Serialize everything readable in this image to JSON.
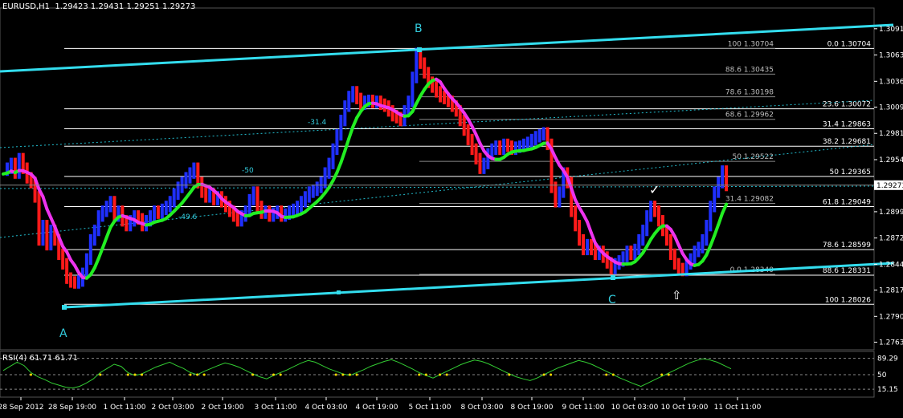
{
  "header": {
    "symbol": "EURUSD,H1",
    "ohlc": "1.29423 1.29431 1.29251 1.29273"
  },
  "rsi_header": {
    "label": "RSI(4) 61.71 61.71"
  },
  "colors": {
    "background": "#000000",
    "bull_bar": "#1f2fff",
    "bear_bar": "#ff1a1a",
    "ma_up": "#22ee22",
    "ma_down": "#ee33ee",
    "channel": "#33ddee",
    "fib_line": "#ffffff",
    "rsi_line": "#33cc33",
    "rsi_dot": "#ffdd00"
  },
  "chart_data": [
    {
      "type": "line",
      "description_source": "EURUSD H1 price panel",
      "y_axis_ticks": [
        "1.30910",
        "1.30635",
        "1.30360",
        "1.30090",
        "1.29815",
        "1.29540",
        "1.29273",
        "1.28995",
        "1.28720",
        "1.28445",
        "1.28175",
        "1.27900",
        "1.27630"
      ],
      "current_price": "1.29273",
      "x_axis_ticks": [
        "28 Sep 2012",
        "28 Sep 19:00",
        "1 Oct 11:00",
        "2 Oct 03:00",
        "2 Oct 19:00",
        "3 Oct 11:00",
        "4 Oct 03:00",
        "4 Oct 19:00",
        "5 Oct 11:00",
        "8 Oct 03:00",
        "8 Oct 19:00",
        "9 Oct 11:00",
        "10 Oct 03:00",
        "10 Oct 19:00",
        "11 Oct 11:00"
      ],
      "wave_labels": [
        "A",
        "B",
        "C"
      ],
      "fib_levels_right": [
        {
          "label": "0.0 1.30704",
          "price": 1.30704
        },
        {
          "label": "23.6 1.30072",
          "price": 1.30072
        },
        {
          "label": "31.4 1.29863",
          "price": 1.29863
        },
        {
          "label": "38.2 1.29681",
          "price": 1.29681
        },
        {
          "label": "50 1.29365",
          "price": 1.29365
        },
        {
          "label": "61.8 1.29049",
          "price": 1.29049
        },
        {
          "label": "78.6 1.28599",
          "price": 1.28599
        },
        {
          "label": "88.6 1.28331",
          "price": 1.28331
        },
        {
          "label": "100 1.28026",
          "price": 1.28026
        }
      ],
      "fib_levels_inner": [
        {
          "label": "100 1.30704",
          "price": 1.30704
        },
        {
          "label": "88.6 1.30435",
          "price": 1.30435
        },
        {
          "label": "78.6 1.30198",
          "price": 1.30198
        },
        {
          "label": "68.6 1.29962",
          "price": 1.29962
        },
        {
          "label": "50 1.29522",
          "price": 1.29522
        },
        {
          "label": "31.4 1.29082",
          "price": 1.29082
        },
        {
          "label": "0.0 1.28340",
          "price": 1.2834
        }
      ],
      "pct_labels": [
        "-31.4",
        "-50",
        "-49.6"
      ],
      "price_path": [
        [
          0,
          1.2943
        ],
        [
          5,
          1.2945
        ],
        [
          10,
          1.295
        ],
        [
          15,
          1.294
        ],
        [
          20,
          1.2955
        ],
        [
          25,
          1.2945
        ],
        [
          30,
          1.2935
        ],
        [
          35,
          1.293
        ],
        [
          40,
          1.2915
        ],
        [
          45,
          1.287
        ],
        [
          50,
          1.2885
        ],
        [
          55,
          1.2865
        ],
        [
          60,
          1.288
        ],
        [
          65,
          1.287
        ],
        [
          70,
          1.2855
        ],
        [
          75,
          1.2845
        ],
        [
          80,
          1.283
        ],
        [
          85,
          1.2826
        ],
        [
          90,
          1.2825
        ],
        [
          95,
          1.2827
        ],
        [
          100,
          1.2835
        ],
        [
          105,
          1.285
        ],
        [
          110,
          1.287
        ],
        [
          115,
          1.288
        ],
        [
          120,
          1.2895
        ],
        [
          125,
          1.29
        ],
        [
          130,
          1.2905
        ],
        [
          135,
          1.291
        ],
        [
          140,
          1.2895
        ],
        [
          145,
          1.29
        ],
        [
          150,
          1.289
        ],
        [
          155,
          1.2885
        ],
        [
          160,
          1.289
        ],
        [
          165,
          1.2895
        ],
        [
          170,
          1.2892
        ],
        [
          175,
          1.2885
        ],
        [
          180,
          1.289
        ],
        [
          185,
          1.2895
        ],
        [
          190,
          1.29
        ],
        [
          195,
          1.2898
        ],
        [
          200,
          1.2902
        ],
        [
          205,
          1.2905
        ],
        [
          210,
          1.291
        ],
        [
          215,
          1.2918
        ],
        [
          220,
          1.2925
        ],
        [
          225,
          1.293
        ],
        [
          230,
          1.2935
        ],
        [
          235,
          1.294
        ],
        [
          240,
          1.2945
        ],
        [
          245,
          1.293
        ],
        [
          250,
          1.292
        ],
        [
          255,
          1.2915
        ],
        [
          260,
          1.2918
        ],
        [
          265,
          1.2912
        ],
        [
          270,
          1.2915
        ],
        [
          275,
          1.291
        ],
        [
          280,
          1.2905
        ],
        [
          285,
          1.29
        ],
        [
          290,
          1.2895
        ],
        [
          295,
          1.289
        ],
        [
          300,
          1.2895
        ],
        [
          305,
          1.29
        ],
        [
          310,
          1.2912
        ],
        [
          315,
          1.292
        ],
        [
          320,
          1.2905
        ],
        [
          325,
          1.2898
        ],
        [
          330,
          1.29
        ],
        [
          335,
          1.2895
        ],
        [
          340,
          1.2898
        ],
        [
          345,
          1.29
        ],
        [
          350,
          1.2895
        ],
        [
          355,
          1.2897
        ],
        [
          360,
          1.29
        ],
        [
          365,
          1.2902
        ],
        [
          370,
          1.2905
        ],
        [
          375,
          1.291
        ],
        [
          380,
          1.2915
        ],
        [
          385,
          1.292
        ],
        [
          390,
          1.2922
        ],
        [
          395,
          1.2925
        ],
        [
          400,
          1.293
        ],
        [
          405,
          1.294
        ],
        [
          410,
          1.295
        ],
        [
          415,
          1.2965
        ],
        [
          420,
          1.298
        ],
        [
          425,
          1.2995
        ],
        [
          430,
          1.301
        ],
        [
          435,
          1.302
        ],
        [
          440,
          1.3025
        ],
        [
          445,
          1.3018
        ],
        [
          450,
          1.3012
        ],
        [
          455,
          1.3015
        ],
        [
          460,
          1.3016
        ],
        [
          465,
          1.3014
        ],
        [
          470,
          1.3015
        ],
        [
          475,
          1.3012
        ],
        [
          480,
          1.301
        ],
        [
          485,
          1.3005
        ],
        [
          490,
          1.3
        ],
        [
          495,
          1.2998
        ],
        [
          500,
          1.2995
        ],
        [
          505,
          1.3005
        ],
        [
          510,
          1.3015
        ],
        [
          515,
          1.304
        ],
        [
          520,
          1.3065
        ],
        [
          525,
          1.3055
        ],
        [
          530,
          1.3045
        ],
        [
          535,
          1.3035
        ],
        [
          540,
          1.303
        ],
        [
          545,
          1.3025
        ],
        [
          550,
          1.302
        ],
        [
          555,
          1.3018
        ],
        [
          560,
          1.3015
        ],
        [
          565,
          1.301
        ],
        [
          570,
          1.3005
        ],
        [
          575,
          1.2995
        ],
        [
          580,
          1.2985
        ],
        [
          585,
          1.2975
        ],
        [
          590,
          1.2965
        ],
        [
          595,
          1.2955
        ],
        [
          600,
          1.2945
        ],
        [
          605,
          1.295
        ],
        [
          610,
          1.296
        ],
        [
          615,
          1.2965
        ],
        [
          620,
          1.2968
        ],
        [
          625,
          1.2965
        ],
        [
          630,
          1.297
        ],
        [
          635,
          1.2968
        ],
        [
          640,
          1.2965
        ],
        [
          645,
          1.2967
        ],
        [
          650,
          1.2968
        ],
        [
          655,
          1.297
        ],
        [
          660,
          1.2972
        ],
        [
          665,
          1.2975
        ],
        [
          670,
          1.2978
        ],
        [
          675,
          1.298
        ],
        [
          680,
          1.2982
        ],
        [
          685,
          1.297
        ],
        [
          690,
          1.2925
        ],
        [
          695,
          1.291
        ],
        [
          700,
          1.292
        ],
        [
          705,
          1.294
        ],
        [
          710,
          1.293
        ],
        [
          715,
          1.29
        ],
        [
          720,
          1.2885
        ],
        [
          725,
          1.287
        ],
        [
          730,
          1.286
        ],
        [
          735,
          1.2865
        ],
        [
          740,
          1.286
        ],
        [
          745,
          1.2855
        ],
        [
          750,
          1.2858
        ],
        [
          755,
          1.2852
        ],
        [
          760,
          1.2846
        ],
        [
          765,
          1.284
        ],
        [
          770,
          1.2845
        ],
        [
          775,
          1.2848
        ],
        [
          780,
          1.2852
        ],
        [
          785,
          1.2858
        ],
        [
          790,
          1.2855
        ],
        [
          795,
          1.286
        ],
        [
          800,
          1.287
        ],
        [
          805,
          1.288
        ],
        [
          810,
          1.2895
        ],
        [
          815,
          1.2905
        ],
        [
          820,
          1.29
        ],
        [
          825,
          1.289
        ],
        [
          830,
          1.288
        ],
        [
          835,
          1.287
        ],
        [
          840,
          1.2855
        ],
        [
          845,
          1.2845
        ],
        [
          850,
          1.284
        ],
        [
          855,
          1.2838
        ],
        [
          860,
          1.2845
        ],
        [
          865,
          1.285
        ],
        [
          870,
          1.2858
        ],
        [
          875,
          1.2862
        ],
        [
          880,
          1.287
        ],
        [
          885,
          1.2885
        ],
        [
          890,
          1.2905
        ],
        [
          895,
          1.292
        ],
        [
          900,
          1.293
        ],
        [
          905,
          1.2942
        ],
        [
          910,
          1.2927
        ]
      ]
    },
    {
      "type": "line",
      "description_source": "RSI(4) sub-panel",
      "y_axis_ticks": [
        "89.29",
        "50",
        "15.15"
      ],
      "ylim": [
        0,
        100
      ],
      "rsi_values": [
        60,
        70,
        80,
        72,
        55,
        45,
        38,
        30,
        25,
        20,
        18,
        22,
        30,
        40,
        55,
        65,
        75,
        70,
        55,
        48,
        52,
        60,
        68,
        74,
        80,
        72,
        65,
        55,
        50,
        58,
        65,
        72,
        78,
        74,
        68,
        60,
        52,
        45,
        40,
        48,
        55,
        62,
        70,
        78,
        84,
        80,
        72,
        64,
        58,
        52,
        48,
        55,
        62,
        70,
        76,
        82,
        86,
        80,
        72,
        64,
        55,
        48,
        42,
        50,
        58,
        66,
        74,
        80,
        85,
        82,
        76,
        68,
        60,
        52,
        45,
        40,
        36,
        42,
        50,
        58,
        66,
        72,
        78,
        84,
        80,
        74,
        66,
        58,
        50,
        42,
        35,
        28,
        22,
        30,
        38,
        46,
        54,
        62,
        70,
        78,
        84,
        88,
        85,
        80,
        72,
        64
      ]
    }
  ]
}
